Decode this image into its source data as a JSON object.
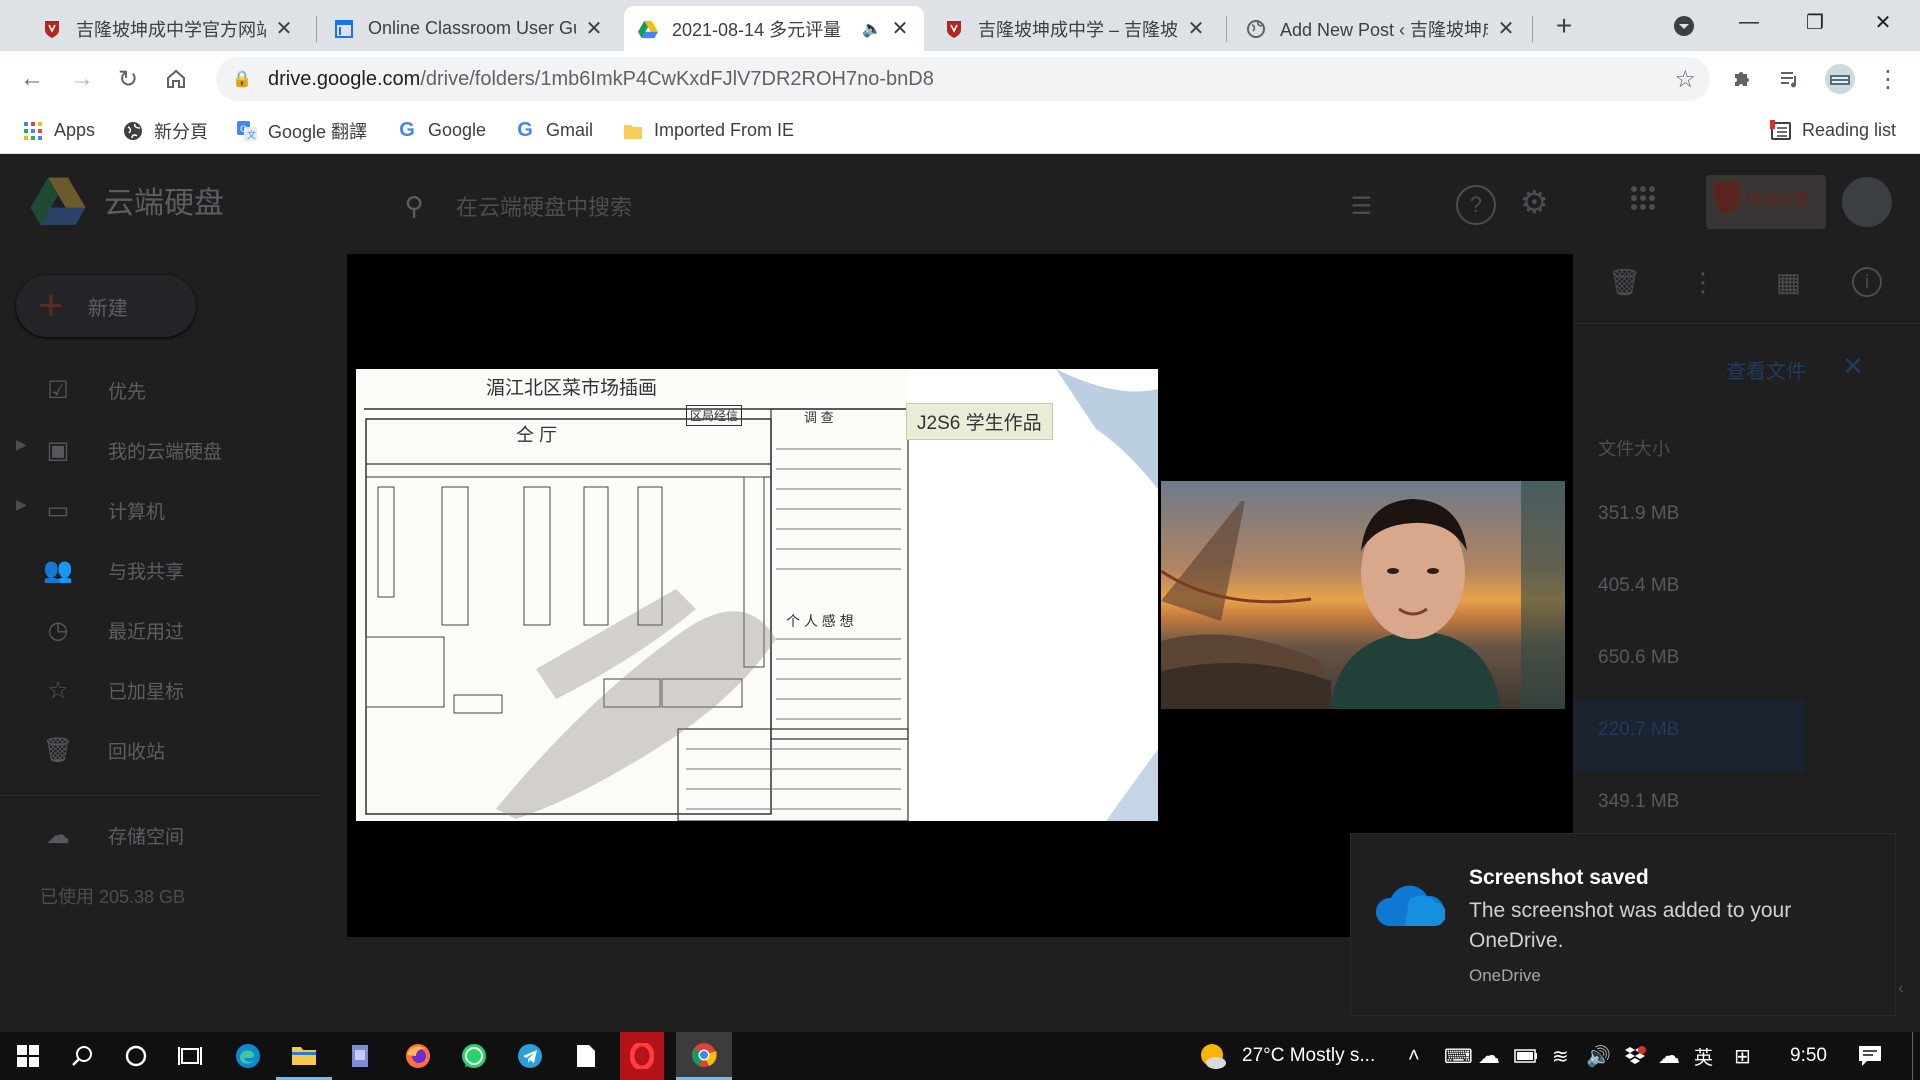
{
  "tabs": [
    {
      "title": "吉隆坡坤成中学官方网站 |",
      "icon": "school-crest-icon",
      "active": false
    },
    {
      "title": "Online Classroom User Gu",
      "icon": "document-page-icon",
      "active": false
    },
    {
      "title": "2021-08-14 多元评量",
      "icon": "google-drive-icon",
      "active": true,
      "audio": true
    },
    {
      "title": "吉隆坡坤成中学 – 吉隆坡",
      "icon": "school-crest-icon",
      "active": false
    },
    {
      "title": "Add New Post ‹ 吉隆坡坤成",
      "icon": "globe-icon",
      "active": false
    }
  ],
  "omnibox": {
    "host": "drive.google.com",
    "path": "/drive/folders/1mb6ImkP4CwKxdFJlV7DR2ROH7no-bnD8"
  },
  "bookmarks": [
    {
      "label": "Apps",
      "icon": "apps-grid-icon"
    },
    {
      "label": "新分頁",
      "icon": "globe-icon"
    },
    {
      "label": "Google 翻譯",
      "icon": "google-translate-icon"
    },
    {
      "label": "Google",
      "icon": "google-icon"
    },
    {
      "label": "Gmail",
      "icon": "google-icon"
    },
    {
      "label": "Imported From IE",
      "icon": "folder-icon"
    }
  ],
  "reading_list": "Reading list",
  "drive": {
    "product": "云端硬盘",
    "search_placeholder": "在云端硬盘中搜索",
    "new_button": "新建",
    "sidebar": [
      {
        "label": "优先",
        "icon": "check-circle-icon"
      },
      {
        "label": "我的云端硬盘",
        "icon": "my-drive-icon"
      },
      {
        "label": "计算机",
        "icon": "computer-icon"
      },
      {
        "label": "与我共享",
        "icon": "people-icon"
      },
      {
        "label": "最近用过",
        "icon": "clock-icon"
      },
      {
        "label": "已加星标",
        "icon": "star-icon"
      },
      {
        "label": "回收站",
        "icon": "trash-icon"
      }
    ],
    "storage_label": "存储空间",
    "storage_used": "已使用 205.38 GB",
    "view_file": "查看文件",
    "size_header": "文件大小",
    "sizes": [
      "351.9 MB",
      "405.4 MB",
      "650.6 MB",
      "220.7 MB",
      "349.1 MB"
    ]
  },
  "video": {
    "slide_tag": "J2S6 学生作品",
    "slide_title": "湄江北区菜市场插画",
    "slide_hall": "仝  厅",
    "slide_area_label": "区局经信",
    "slide_col_head": "调  查",
    "slide_thoughts": "个 人 感 想"
  },
  "toast": {
    "title": "Screenshot saved",
    "body": "The screenshot was added to your OneDrive.",
    "source": "OneDrive"
  },
  "taskbar": {
    "weather": "27°C  Mostly s...",
    "ime": "英",
    "time": "9:50"
  },
  "colors": {
    "chrome_tabstrip": "#dee1e6",
    "drive_dim_bg": "#1f1f1f",
    "onedrive_blue": "#0f78d4"
  }
}
